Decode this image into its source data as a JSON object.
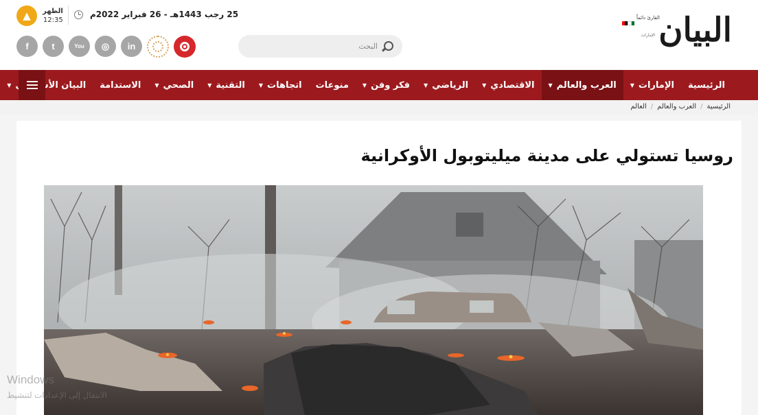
{
  "header": {
    "logo": {
      "main": "البيان",
      "tagline": "القارئ دائماً",
      "subline": "الإمارات",
      "flag_colors": [
        "#00732f",
        "#ffffff",
        "#000000",
        "#ff0000"
      ]
    },
    "date": "25 رجب 1443هـ - 26 فبراير 2022م",
    "prayer": {
      "name": "الظهر",
      "time": "12:35"
    },
    "search": {
      "placeholder": "البحث"
    },
    "socials": [
      {
        "name": "facebook",
        "glyph": "f"
      },
      {
        "name": "twitter",
        "glyph": "t"
      },
      {
        "name": "youtube",
        "glyph": "You"
      },
      {
        "name": "instagram",
        "glyph": "◎"
      },
      {
        "name": "linkedin",
        "glyph": "in"
      }
    ]
  },
  "nav": {
    "items": [
      {
        "label": "الرئيسية",
        "caret": false,
        "active": false
      },
      {
        "label": "الإمارات",
        "caret": true,
        "active": false
      },
      {
        "label": "العرب والعالم",
        "caret": true,
        "active": true
      },
      {
        "label": "الاقتصادي",
        "caret": true,
        "active": false
      },
      {
        "label": "الرياضي",
        "caret": true,
        "active": false
      },
      {
        "label": "فكر وفن",
        "caret": true,
        "active": false
      },
      {
        "label": "منوعات",
        "caret": false,
        "active": false
      },
      {
        "label": "اتجاهات",
        "caret": true,
        "active": false
      },
      {
        "label": "التقنية",
        "caret": true,
        "active": false
      },
      {
        "label": "الصحي",
        "caret": true,
        "active": false
      },
      {
        "label": "الاستدامة",
        "caret": false,
        "active": false
      },
      {
        "label": "البيان الأسبوعي",
        "caret": true,
        "active": false
      }
    ],
    "caret_glyph": "▼"
  },
  "breadcrumb": {
    "items": [
      "الرئيسية",
      "العرب والعالم",
      "العالم"
    ],
    "separator": "/"
  },
  "article": {
    "title": "روسيا تستولي على مدينة ميليتوبول الأوكرانية"
  },
  "watermark": {
    "line1": "Windows",
    "line2": "الانتقال إلى الإعدادات لتنشيط"
  },
  "colors": {
    "nav_bg": "#9c1a1e",
    "nav_active": "#7a1114",
    "prayer_icon": "#f0a818",
    "podcast": "#d6282c",
    "social_gray": "#a6a6a6"
  }
}
